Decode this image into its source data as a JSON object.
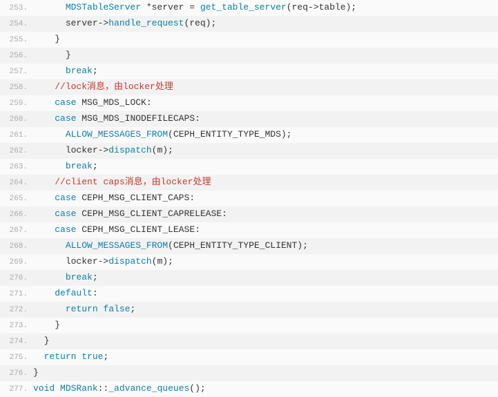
{
  "lines": [
    {
      "n": "253.",
      "indent": "      ",
      "tokens": [
        {
          "t": "MDSTableServer",
          "c": "type"
        },
        {
          "t": " *server = ",
          "c": "plain"
        },
        {
          "t": "get_table_server",
          "c": "fn"
        },
        {
          "t": "(req->table);",
          "c": "plain"
        }
      ]
    },
    {
      "n": "254.",
      "indent": "      ",
      "tokens": [
        {
          "t": "server->",
          "c": "plain"
        },
        {
          "t": "handle_request",
          "c": "fn"
        },
        {
          "t": "(req);",
          "c": "plain"
        }
      ]
    },
    {
      "n": "255.",
      "indent": "    ",
      "tokens": [
        {
          "t": "}",
          "c": "plain"
        }
      ]
    },
    {
      "n": "256.",
      "indent": "      ",
      "tokens": [
        {
          "t": "}",
          "c": "plain"
        }
      ]
    },
    {
      "n": "257.",
      "indent": "      ",
      "tokens": [
        {
          "t": "break",
          "c": "kw"
        },
        {
          "t": ";",
          "c": "plain"
        }
      ]
    },
    {
      "n": "258.",
      "indent": "    ",
      "tokens": [
        {
          "t": "//lock消息，由locker处理",
          "c": "cmt"
        }
      ]
    },
    {
      "n": "259.",
      "indent": "    ",
      "tokens": [
        {
          "t": "case",
          "c": "kw"
        },
        {
          "t": " MSG_MDS_LOCK:",
          "c": "plain"
        }
      ]
    },
    {
      "n": "260.",
      "indent": "    ",
      "tokens": [
        {
          "t": "case",
          "c": "kw"
        },
        {
          "t": " MSG_MDS_INODEFILECAPS:",
          "c": "plain"
        }
      ]
    },
    {
      "n": "261.",
      "indent": "      ",
      "tokens": [
        {
          "t": "ALLOW_MESSAGES_FROM",
          "c": "fn"
        },
        {
          "t": "(CEPH_ENTITY_TYPE_MDS);",
          "c": "plain"
        }
      ]
    },
    {
      "n": "262.",
      "indent": "      ",
      "tokens": [
        {
          "t": "locker->",
          "c": "plain"
        },
        {
          "t": "dispatch",
          "c": "fn"
        },
        {
          "t": "(m);",
          "c": "plain"
        }
      ]
    },
    {
      "n": "263.",
      "indent": "      ",
      "tokens": [
        {
          "t": "break",
          "c": "kw"
        },
        {
          "t": ";",
          "c": "plain"
        }
      ]
    },
    {
      "n": "264.",
      "indent": "    ",
      "tokens": [
        {
          "t": "//client caps消息，由locker处理",
          "c": "cmt"
        }
      ]
    },
    {
      "n": "265.",
      "indent": "    ",
      "tokens": [
        {
          "t": "case",
          "c": "kw"
        },
        {
          "t": " CEPH_MSG_CLIENT_CAPS:",
          "c": "plain"
        }
      ]
    },
    {
      "n": "266.",
      "indent": "    ",
      "tokens": [
        {
          "t": "case",
          "c": "kw"
        },
        {
          "t": " CEPH_MSG_CLIENT_CAPRELEASE:",
          "c": "plain"
        }
      ]
    },
    {
      "n": "267.",
      "indent": "    ",
      "tokens": [
        {
          "t": "case",
          "c": "kw"
        },
        {
          "t": " CEPH_MSG_CLIENT_LEASE:",
          "c": "plain"
        }
      ]
    },
    {
      "n": "268.",
      "indent": "      ",
      "tokens": [
        {
          "t": "ALLOW_MESSAGES_FROM",
          "c": "fn"
        },
        {
          "t": "(CEPH_ENTITY_TYPE_CLIENT);",
          "c": "plain"
        }
      ]
    },
    {
      "n": "269.",
      "indent": "      ",
      "tokens": [
        {
          "t": "locker->",
          "c": "plain"
        },
        {
          "t": "dispatch",
          "c": "fn"
        },
        {
          "t": "(m);",
          "c": "plain"
        }
      ]
    },
    {
      "n": "270.",
      "indent": "      ",
      "tokens": [
        {
          "t": "break",
          "c": "kw"
        },
        {
          "t": ";",
          "c": "plain"
        }
      ]
    },
    {
      "n": "271.",
      "indent": "    ",
      "tokens": [
        {
          "t": "default",
          "c": "kw"
        },
        {
          "t": ":",
          "c": "plain"
        }
      ]
    },
    {
      "n": "272.",
      "indent": "      ",
      "tokens": [
        {
          "t": "return",
          "c": "kw"
        },
        {
          "t": " ",
          "c": "plain"
        },
        {
          "t": "false",
          "c": "bool"
        },
        {
          "t": ";",
          "c": "plain"
        }
      ]
    },
    {
      "n": "273.",
      "indent": "    ",
      "tokens": [
        {
          "t": "}",
          "c": "plain"
        }
      ]
    },
    {
      "n": "274.",
      "indent": "  ",
      "tokens": [
        {
          "t": "}",
          "c": "plain"
        }
      ]
    },
    {
      "n": "275.",
      "indent": "  ",
      "tokens": [
        {
          "t": "return",
          "c": "kw"
        },
        {
          "t": " ",
          "c": "plain"
        },
        {
          "t": "true",
          "c": "bool"
        },
        {
          "t": ";",
          "c": "plain"
        }
      ]
    },
    {
      "n": "276.",
      "indent": "",
      "tokens": [
        {
          "t": "}",
          "c": "plain"
        }
      ]
    },
    {
      "n": "277.",
      "indent": "",
      "tokens": [
        {
          "t": "void",
          "c": "kw"
        },
        {
          "t": " ",
          "c": "plain"
        },
        {
          "t": "MDSRank",
          "c": "type"
        },
        {
          "t": "::",
          "c": "plain"
        },
        {
          "t": "_advance_queues",
          "c": "fn"
        },
        {
          "t": "();",
          "c": "plain"
        }
      ]
    }
  ]
}
